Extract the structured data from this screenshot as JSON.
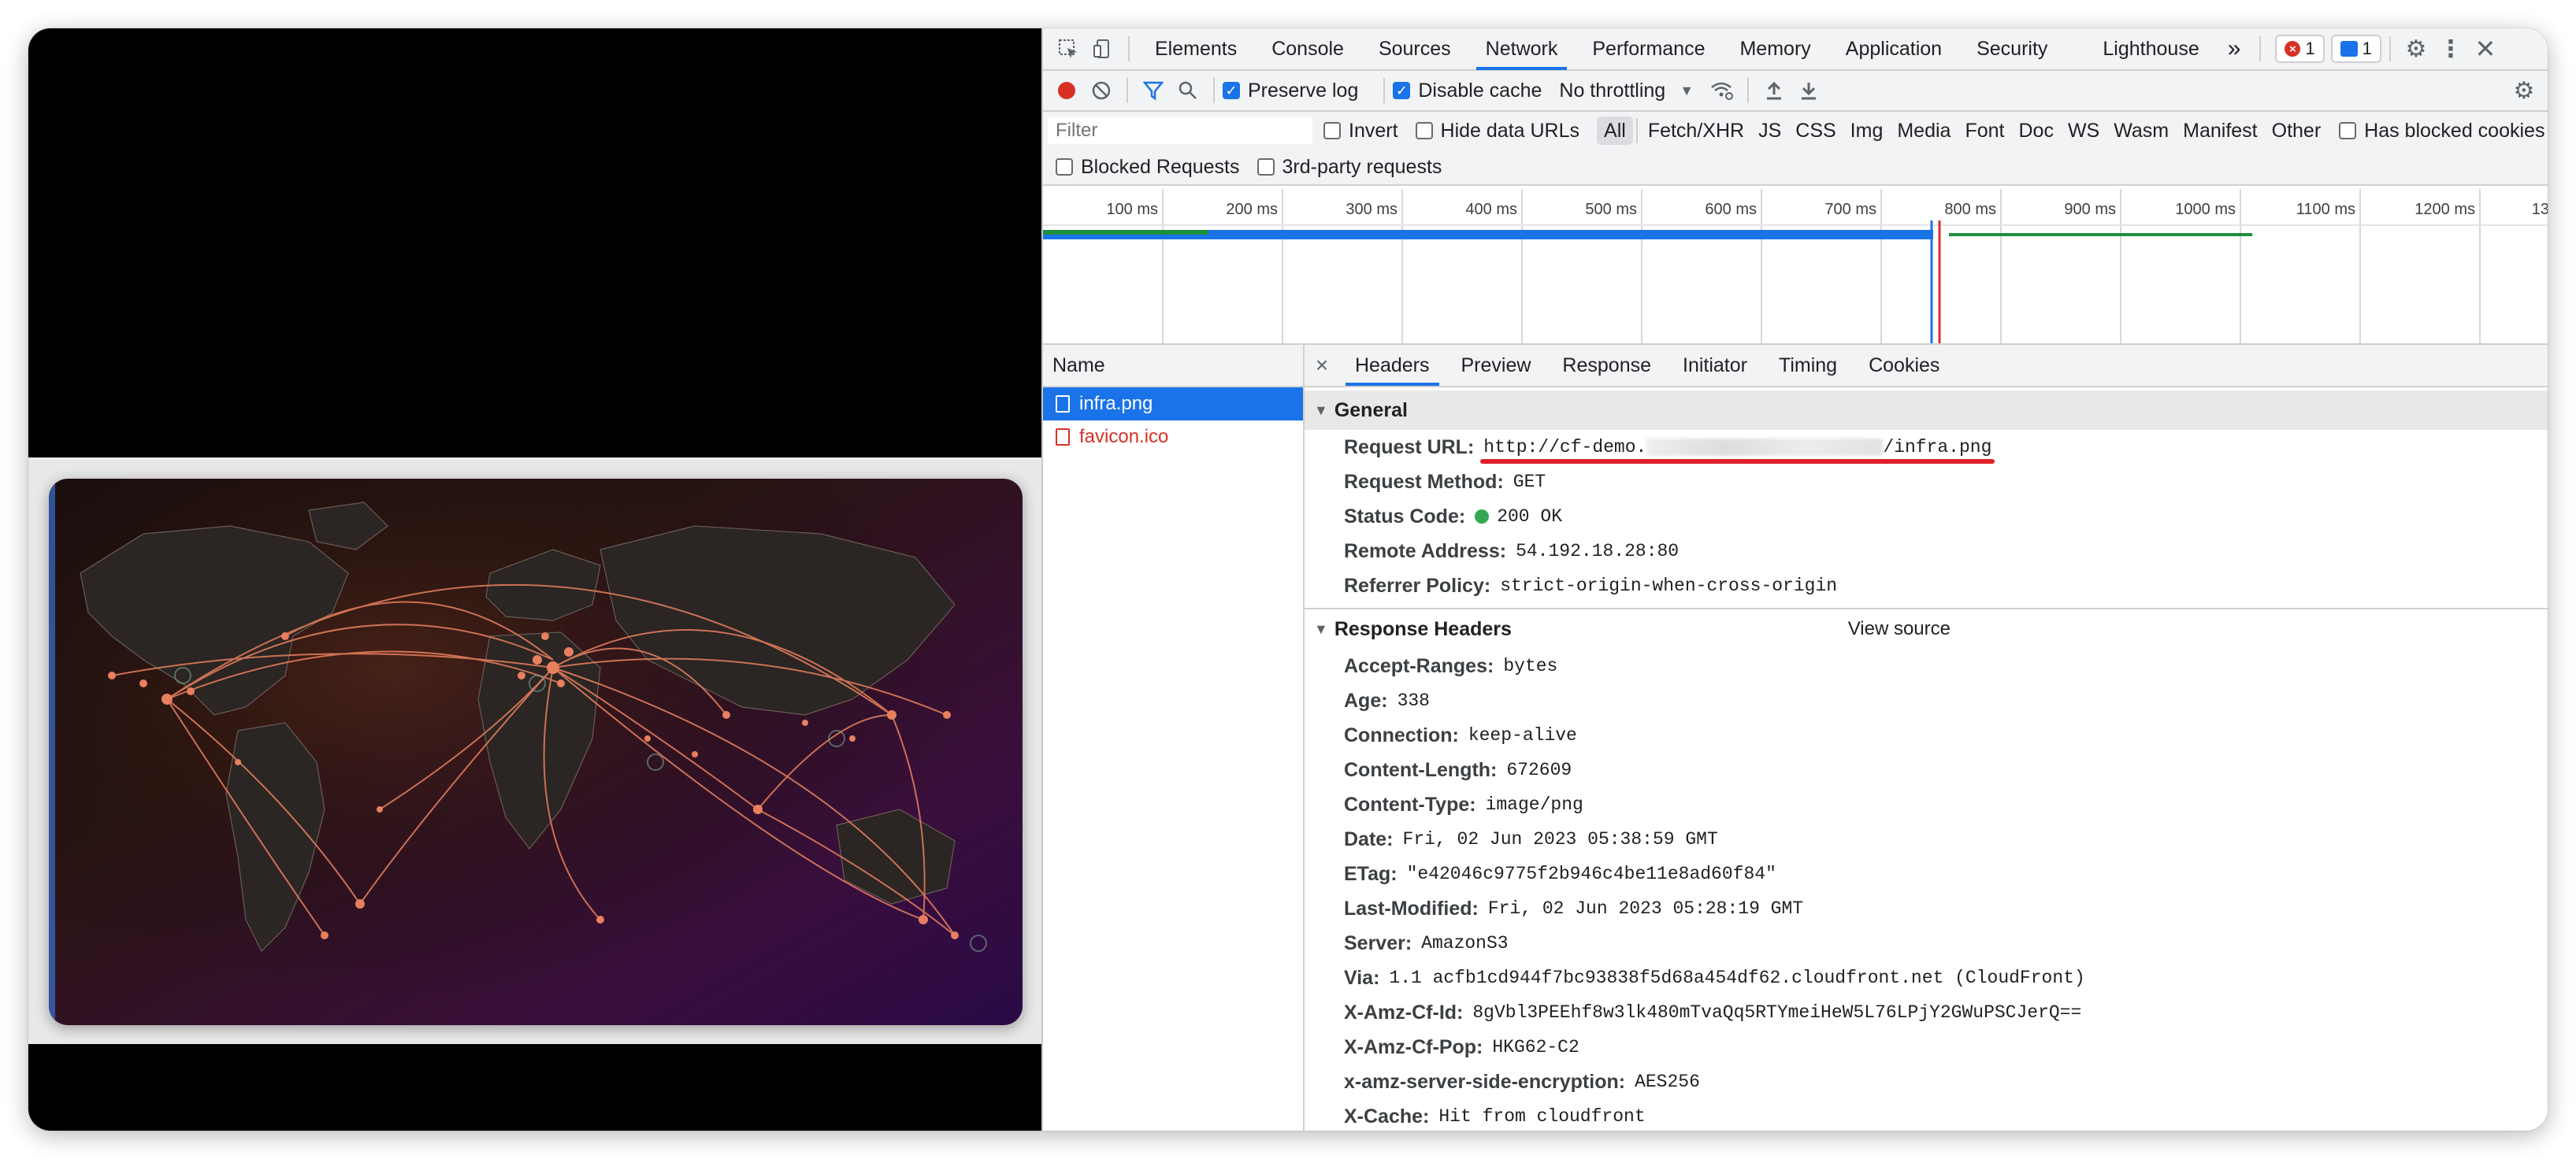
{
  "devtools": {
    "tabs": [
      "Elements",
      "Console",
      "Sources",
      "Network",
      "Performance",
      "Memory",
      "Application",
      "Security",
      "Lighthouse"
    ],
    "active_tab": "Network",
    "more_tabs": "»",
    "error_count": "1",
    "message_count": "1",
    "toolbar": {
      "preserve_log": "Preserve log",
      "disable_cache": "Disable cache",
      "throttling": "No throttling"
    },
    "filter": {
      "placeholder": "Filter",
      "invert": "Invert",
      "hide_data_urls": "Hide data URLs",
      "types": [
        "All",
        "Fetch/XHR",
        "JS",
        "CSS",
        "Img",
        "Media",
        "Font",
        "Doc",
        "WS",
        "Wasm",
        "Manifest",
        "Other"
      ],
      "has_blocked_cookies": "Has blocked cookies",
      "blocked_requests": "Blocked Requests",
      "third_party": "3rd-party requests"
    },
    "timeline": {
      "ticks": [
        "100 ms",
        "200 ms",
        "300 ms",
        "400 ms",
        "500 ms",
        "600 ms",
        "700 ms",
        "800 ms",
        "900 ms",
        "1000 ms",
        "1100 ms",
        "1200 ms",
        "13"
      ]
    },
    "requests": {
      "header": "Name",
      "rows": [
        {
          "name": "infra.png"
        },
        {
          "name": "favicon.ico"
        }
      ]
    },
    "details": {
      "tabs": [
        "Headers",
        "Preview",
        "Response",
        "Initiator",
        "Timing",
        "Cookies"
      ],
      "active_tab": "Headers",
      "general": {
        "title": "General",
        "request_url_label": "Request URL:",
        "request_url_prefix": "http://cf-demo.",
        "request_url_suffix": "/infra.png",
        "request_method_label": "Request Method:",
        "request_method": "GET",
        "status_code_label": "Status Code:",
        "status_code": "200 OK",
        "remote_address_label": "Remote Address:",
        "remote_address": "54.192.18.28:80",
        "referrer_policy_label": "Referrer Policy:",
        "referrer_policy": "strict-origin-when-cross-origin"
      },
      "response_headers": {
        "title": "Response Headers",
        "view_source": "View source",
        "items": [
          {
            "k": "Accept-Ranges:",
            "v": "bytes"
          },
          {
            "k": "Age:",
            "v": "338"
          },
          {
            "k": "Connection:",
            "v": "keep-alive"
          },
          {
            "k": "Content-Length:",
            "v": "672609"
          },
          {
            "k": "Content-Type:",
            "v": "image/png"
          },
          {
            "k": "Date:",
            "v": "Fri, 02 Jun 2023 05:38:59 GMT"
          },
          {
            "k": "ETag:",
            "v": "\"e42046c9775f2b946c4be11e8ad60f84\""
          },
          {
            "k": "Last-Modified:",
            "v": "Fri, 02 Jun 2023 05:28:19 GMT"
          },
          {
            "k": "Server:",
            "v": "AmazonS3"
          },
          {
            "k": "Via:",
            "v": "1.1 acfb1cd944f7bc93838f5d68a454df62.cloudfront.net (CloudFront)"
          },
          {
            "k": "X-Amz-Cf-Id:",
            "v": "8gVbl3PEEhf8w3lk480mTvaQq5RTYmeiHeW5L76LPjY2GWuPSCJerQ=="
          },
          {
            "k": "X-Amz-Cf-Pop:",
            "v": "HKG62-C2"
          },
          {
            "k": "x-amz-server-side-encryption:",
            "v": "AES256"
          },
          {
            "k": "X-Cache:",
            "v": "Hit from cloudfront"
          }
        ]
      }
    }
  },
  "colors": {
    "accent": "#1a73e8",
    "error": "#d93025",
    "status_ok": "#34a853",
    "annotation": "#e0202a",
    "map_route": "#e8805e"
  }
}
